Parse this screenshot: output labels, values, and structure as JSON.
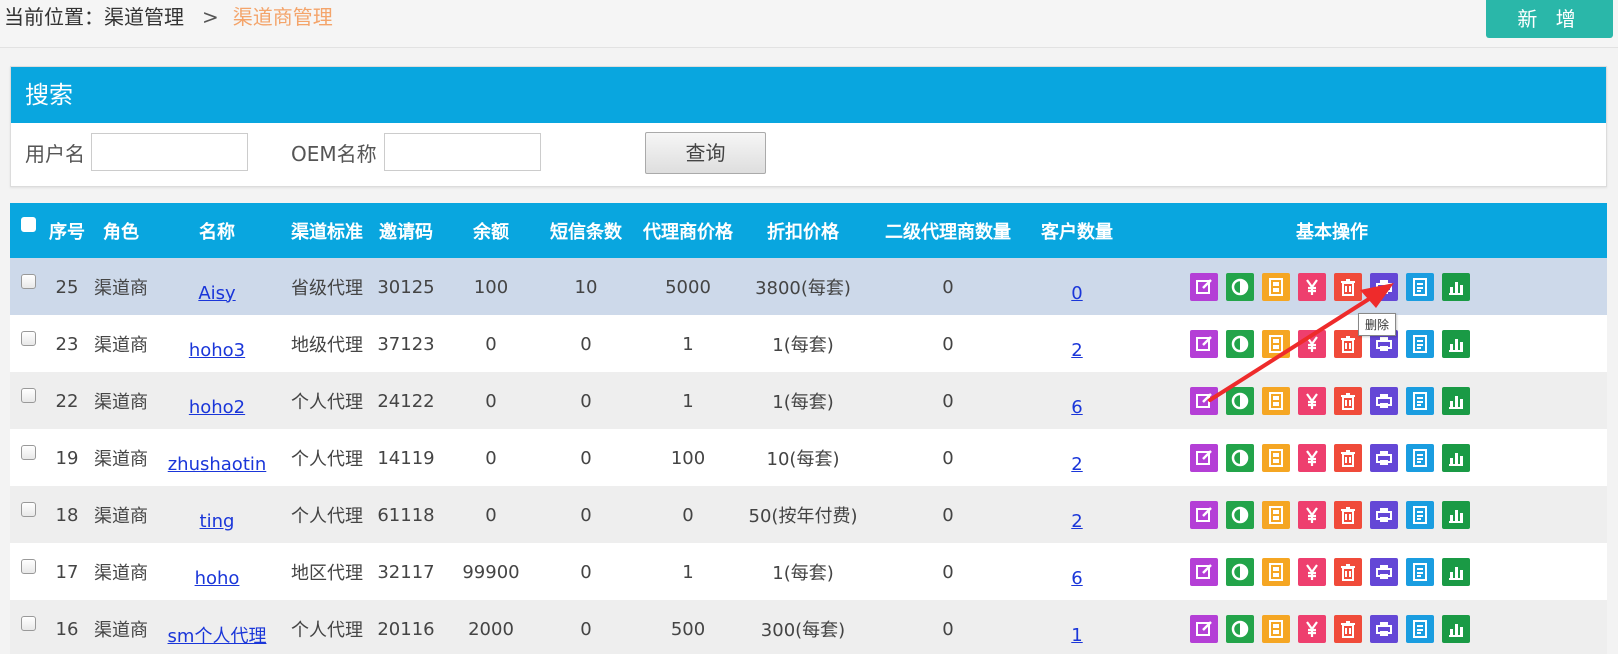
{
  "breadcrumb": {
    "prefix": "当前位置：渠道管理",
    "separator": ">",
    "current": "渠道商管理"
  },
  "header": {
    "add_label": "新 增"
  },
  "search": {
    "title": "搜索",
    "username_label": "用户名",
    "username_value": "",
    "oem_label": "OEM名称",
    "oem_value": "",
    "query_label": "查询"
  },
  "table": {
    "columns": [
      "序号",
      "角色",
      "名称",
      "渠道标准",
      "邀请码",
      "余额",
      "短信条数",
      "代理商价格",
      "折扣价格",
      "二级代理商数量",
      "客户数量",
      "基本操作"
    ],
    "rows": [
      {
        "id": "25",
        "role": "渠道商",
        "name": "Aisy",
        "standard": "省级代理",
        "code": "30125",
        "balance": "100",
        "sms": "10",
        "price": "5000",
        "discount": "3800(每套)",
        "sub": "0",
        "clients": "0"
      },
      {
        "id": "23",
        "role": "渠道商",
        "name": "hoho3",
        "standard": "地级代理",
        "code": "37123",
        "balance": "0",
        "sms": "0",
        "price": "1",
        "discount": "1(每套)",
        "sub": "0",
        "clients": "2"
      },
      {
        "id": "22",
        "role": "渠道商",
        "name": "hoho2",
        "standard": "个人代理",
        "code": "24122",
        "balance": "0",
        "sms": "0",
        "price": "1",
        "discount": "1(每套)",
        "sub": "0",
        "clients": "6"
      },
      {
        "id": "19",
        "role": "渠道商",
        "name": "zhushaotin",
        "standard": "个人代理",
        "code": "14119",
        "balance": "0",
        "sms": "0",
        "price": "100",
        "discount": "10(每套)",
        "sub": "0",
        "clients": "2"
      },
      {
        "id": "18",
        "role": "渠道商",
        "name": "ting",
        "standard": "个人代理",
        "code": "61118",
        "balance": "0",
        "sms": "0",
        "price": "0",
        "discount": "50(按年付费)",
        "sub": "0",
        "clients": "2"
      },
      {
        "id": "17",
        "role": "渠道商",
        "name": "hoho",
        "standard": "地区代理",
        "code": "32117",
        "balance": "99900",
        "sms": "0",
        "price": "1",
        "discount": "1(每套)",
        "sub": "0",
        "clients": "6"
      },
      {
        "id": "16",
        "role": "渠道商",
        "name": "sm个人代理",
        "standard": "个人代理",
        "code": "20116",
        "balance": "2000",
        "sms": "0",
        "price": "500",
        "discount": "300(每套)",
        "sub": "0",
        "clients": "1"
      }
    ],
    "operations": [
      {
        "icon": "edit-icon",
        "color": "#b43fd6"
      },
      {
        "icon": "toggle-icon",
        "color": "#23a44a"
      },
      {
        "icon": "film-icon",
        "color": "#f5a623"
      },
      {
        "icon": "yen-icon",
        "color": "#ee3f6e"
      },
      {
        "icon": "trash-icon",
        "color": "#f04b3a"
      },
      {
        "icon": "print-icon",
        "color": "#6447d6"
      },
      {
        "icon": "document-icon",
        "color": "#1a9de0"
      },
      {
        "icon": "chart-icon",
        "color": "#1a9a45"
      }
    ]
  },
  "tooltip": {
    "text": "删除"
  },
  "colors": {
    "header_blue": "#09a6df",
    "add_button": "#2ab7a9",
    "breadcrumb_current": "#f4a46a",
    "link": "#1a36d9",
    "arrow": "#ee2b2b"
  }
}
